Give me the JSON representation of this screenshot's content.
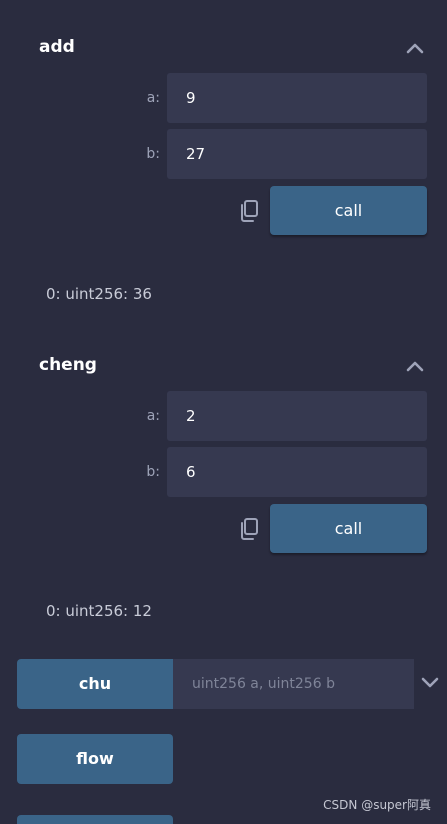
{
  "functions": [
    {
      "name": "add",
      "params": [
        {
          "label": "a:",
          "value": "9"
        },
        {
          "label": "b:",
          "value": "27"
        }
      ],
      "call_label": "call",
      "result": "0: uint256: 36"
    },
    {
      "name": "cheng",
      "params": [
        {
          "label": "a:",
          "value": "2"
        },
        {
          "label": "b:",
          "value": "6"
        }
      ],
      "call_label": "call",
      "result": "0: uint256: 12"
    }
  ],
  "chu": {
    "label": "chu",
    "placeholder": "uint256 a, uint256 b"
  },
  "flow": {
    "label": "flow"
  },
  "watermark": "CSDN @super阿真",
  "icons": {
    "collapse": "chevron-up-icon",
    "expand": "chevron-down-icon",
    "copy": "copy-icon"
  },
  "colors": {
    "background": "#2a2c3f",
    "input_bg": "#363950",
    "button_bg": "#3a6488"
  }
}
